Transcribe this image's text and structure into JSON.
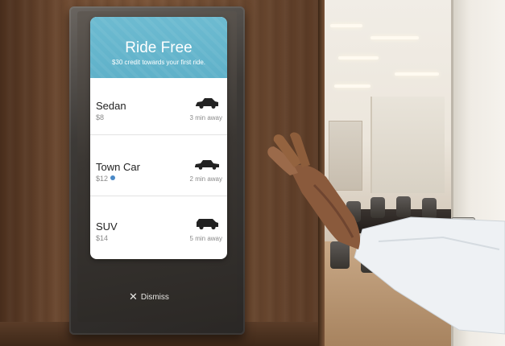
{
  "promo": {
    "title": "Ride Free",
    "subtitle": "$30 credit towards your first ride."
  },
  "rides": [
    {
      "name": "Sedan",
      "price": "$8",
      "eta": "3 min away",
      "icon": "sedan-icon",
      "has_info": false
    },
    {
      "name": "Town Car",
      "price": "$12",
      "eta": "2 min away",
      "icon": "town-car-icon",
      "has_info": true
    },
    {
      "name": "SUV",
      "price": "$14",
      "eta": "5 min away",
      "icon": "suv-icon",
      "has_info": false
    }
  ],
  "dismiss": {
    "label": "Dismiss",
    "icon": "close-icon"
  },
  "colors": {
    "promo_bg": "#5fb1c9",
    "card_bg": "#ffffff",
    "info_dot": "#4a89c7"
  }
}
